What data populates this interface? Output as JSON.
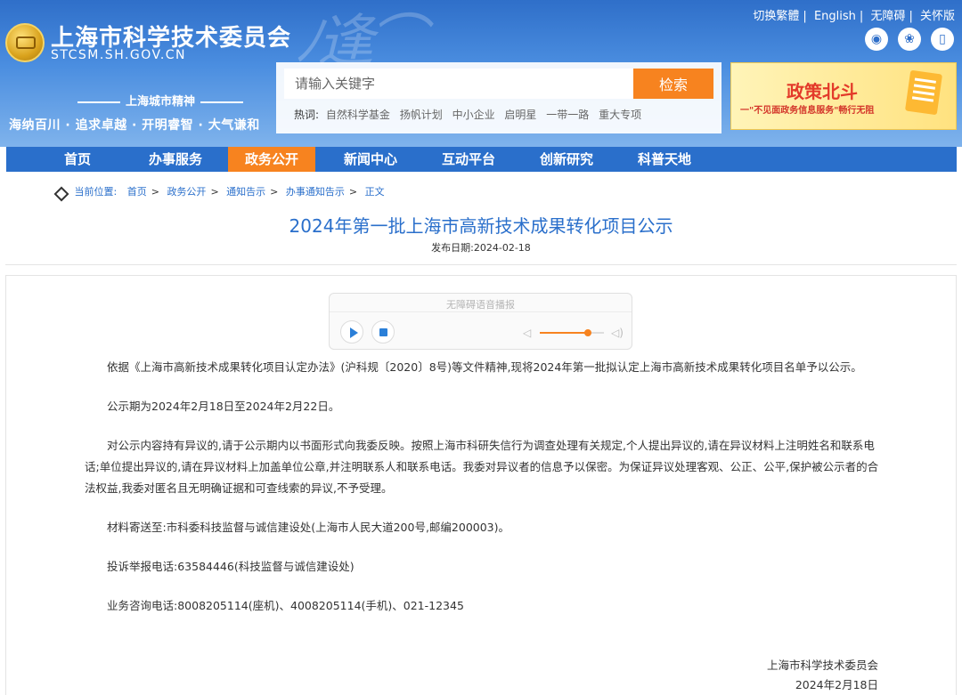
{
  "header": {
    "site_name": "上海市科学技术委员会",
    "site_domain": "STCSM.SH.GOV.CN",
    "spirit_title": "上海城市精神",
    "spirit_motto": "海纳百川 · 追求卓越 · 开明睿智 · 大气谦和",
    "top_links": [
      "切换繁體",
      "English",
      "无障碍",
      "关怀版"
    ],
    "social_icons": [
      "weibo-icon",
      "wechat-icon",
      "mobile-icon"
    ]
  },
  "search": {
    "placeholder": "请输入关键字",
    "button_label": "检索",
    "hot_label": "热词:",
    "hot_words": [
      "自然科学基金",
      "扬帆计划",
      "中小企业",
      "启明星",
      "一带一路",
      "重大专项"
    ]
  },
  "banner": {
    "title": "政策北斗",
    "subtitle": "一\"不见面政务信息服务\"畅行无阻"
  },
  "nav": {
    "items": [
      "首页",
      "办事服务",
      "政务公开",
      "新闻中心",
      "互动平台",
      "创新研究",
      "科普天地"
    ],
    "active_index": 2
  },
  "breadcrumb": {
    "label": "当前位置:",
    "items": [
      "首页",
      "政务公开",
      "通知告示",
      "办事通知告示",
      "正文"
    ]
  },
  "article": {
    "title": "2024年第一批上海市高新技术成果转化项目公示",
    "publish_date": "发布日期:2024-02-18",
    "paragraphs": [
      "依据《上海市高新技术成果转化项目认定办法》(沪科规〔2020〕8号)等文件精神,现将2024年第一批拟认定上海市高新技术成果转化项目名单予以公示。",
      "公示期为2024年2月18日至2024年2月22日。",
      "对公示内容持有异议的,请于公示期内以书面形式向我委反映。按照上海市科研失信行为调查处理有关规定,个人提出异议的,请在异议材料上注明姓名和联系电话;单位提出异议的,请在异议材料上加盖单位公章,并注明联系人和联系电话。我委对异议者的信息予以保密。为保证异议处理客观、公正、公平,保护被公示者的合法权益,我委对匿名且无明确证据和可查线索的异议,不予受理。",
      "材料寄送至:市科委科技监督与诚信建设处(上海市人民大道200号,邮编200003)。",
      "投诉举报电话:63584446(科技监督与诚信建设处)",
      "业务咨询电话:8008205114(座机)、4008205114(手机)、021-12345"
    ],
    "signature_org": "上海市科学技术委员会",
    "signature_date": "2024年2月18日"
  },
  "player": {
    "label": "无障碍语音播报",
    "volume": 0.75
  },
  "colors": {
    "primary_blue": "#2a6fcb",
    "accent_orange": "#f7831f"
  }
}
